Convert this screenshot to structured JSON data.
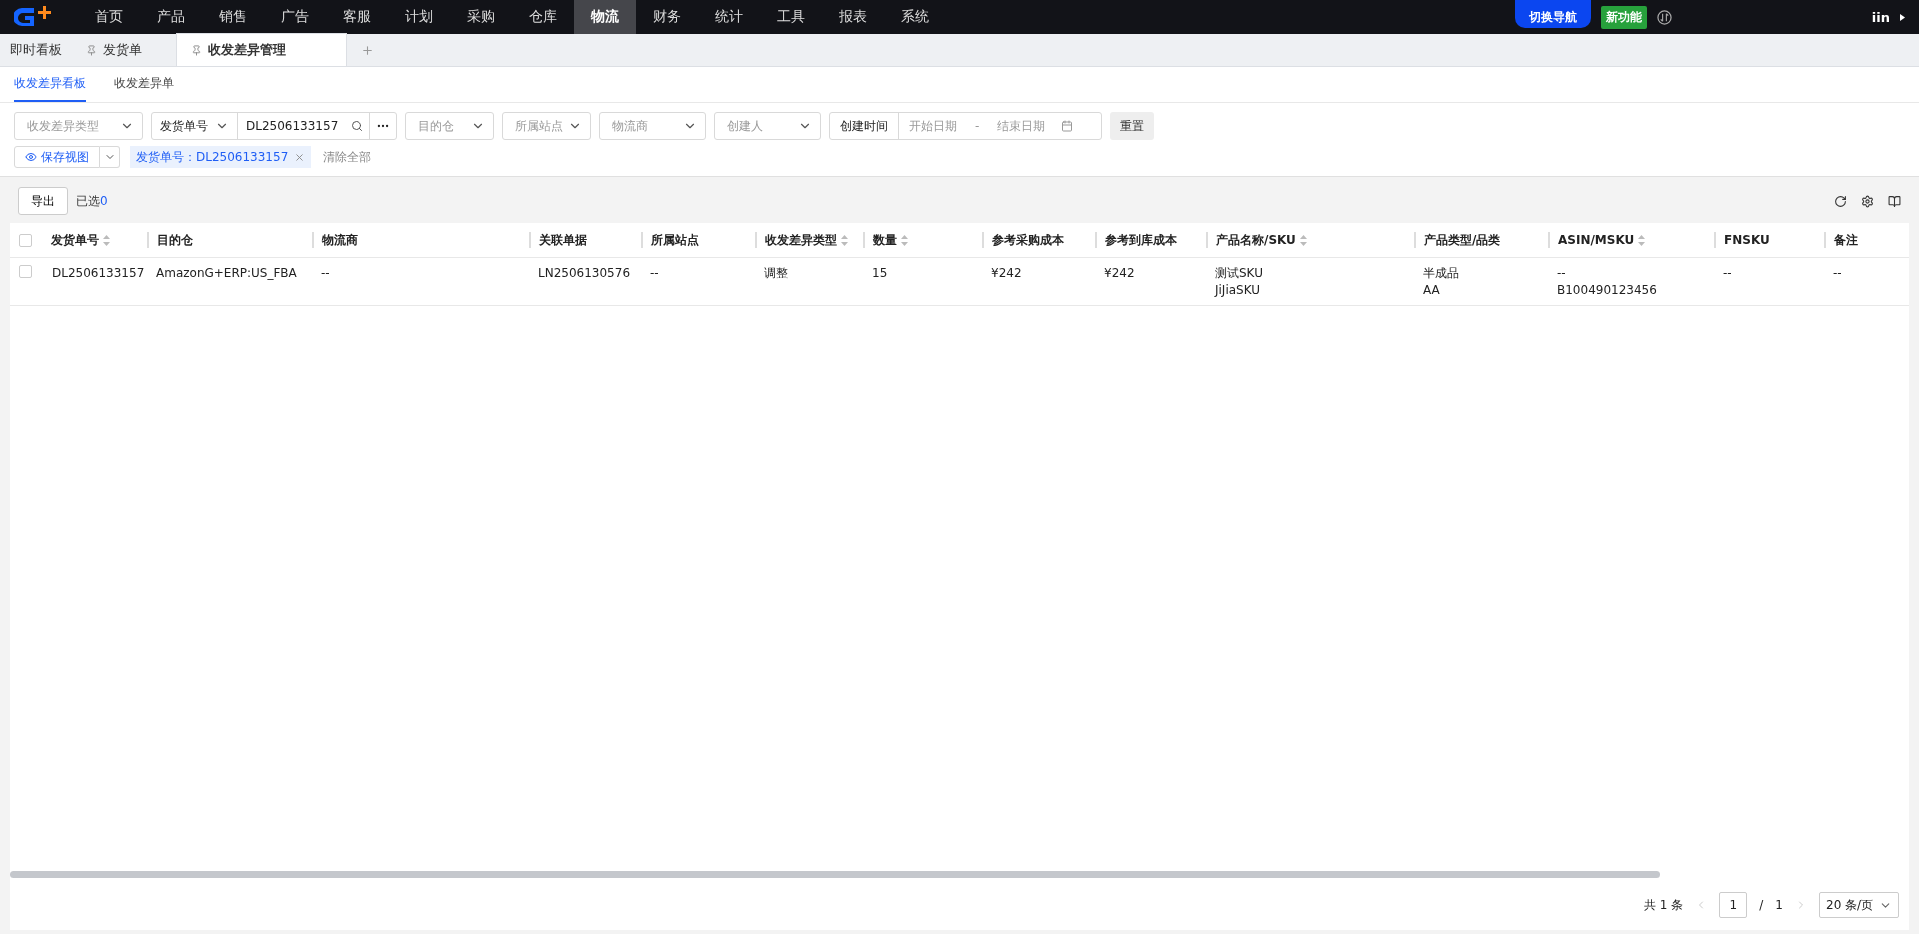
{
  "nav": {
    "items": [
      {
        "label": "首页",
        "selected": false
      },
      {
        "label": "产品",
        "selected": false
      },
      {
        "label": "销售",
        "selected": false
      },
      {
        "label": "广告",
        "selected": false
      },
      {
        "label": "客服",
        "selected": false
      },
      {
        "label": "计划",
        "selected": false
      },
      {
        "label": "采购",
        "selected": false
      },
      {
        "label": "仓库",
        "selected": false
      },
      {
        "label": "物流",
        "selected": true
      },
      {
        "label": "财务",
        "selected": false
      },
      {
        "label": "统计",
        "selected": false
      },
      {
        "label": "工具",
        "selected": false
      },
      {
        "label": "报表",
        "selected": false
      },
      {
        "label": "系统",
        "selected": false
      }
    ],
    "switch_button": "切换导航",
    "new_badge": "新功能",
    "user": "iin"
  },
  "page_tabs": [
    {
      "label": "即时看板",
      "pinned": false,
      "selected": false
    },
    {
      "label": "发货单",
      "pinned": true,
      "selected": false
    },
    {
      "label": "收发差异管理",
      "pinned": true,
      "selected": true
    }
  ],
  "sub_tabs": [
    {
      "label": "收发差异看板",
      "selected": true
    },
    {
      "label": "收发差异单",
      "selected": false
    }
  ],
  "filters": [
    {
      "kind": "select",
      "placeholder": "收发差异类型"
    },
    {
      "kind": "combo",
      "field": "发货单号",
      "value": "DL2506133157"
    },
    {
      "kind": "select",
      "placeholder": "目的仓"
    },
    {
      "kind": "select",
      "placeholder": "所属站点"
    },
    {
      "kind": "select",
      "placeholder": "物流商"
    },
    {
      "kind": "select",
      "placeholder": "创建人"
    },
    {
      "kind": "daterange",
      "label": "创建时间",
      "start_placeholder": "开始日期",
      "separator": "-",
      "end_placeholder": "结束日期"
    },
    {
      "kind": "button",
      "label": "重置"
    }
  ],
  "save_view": "保存视图",
  "active_filter": "发货单号：DL2506133157",
  "clear_all": "清除全部",
  "toolbar": {
    "export": "导出",
    "selected_label": "已选",
    "selected_count": "0"
  },
  "table": {
    "select_all_checked": false,
    "columns": [
      {
        "label": "发货单号",
        "sortable": true
      },
      {
        "label": "目的仓",
        "sortable": false
      },
      {
        "label": "物流商",
        "sortable": false
      },
      {
        "label": "关联单据",
        "sortable": false
      },
      {
        "label": "所属站点",
        "sortable": false
      },
      {
        "label": "收发差异类型",
        "sortable": true
      },
      {
        "label": "数量",
        "sortable": true
      },
      {
        "label": "参考采购成本",
        "sortable": false
      },
      {
        "label": "参考到库成本",
        "sortable": false
      },
      {
        "label": "产品名称/SKU",
        "sortable": true
      },
      {
        "label": "产品类型/品类",
        "sortable": false
      },
      {
        "label": "ASIN/MSKU",
        "sortable": true
      },
      {
        "label": "FNSKU",
        "sortable": false
      },
      {
        "label": "备注",
        "sortable": false
      }
    ],
    "rows": [
      {
        "checked": false,
        "cells": [
          [
            "DL2506133157"
          ],
          [
            "AmazonG+ERP:US_FBA"
          ],
          [
            "--"
          ],
          [
            "LN2506130576"
          ],
          [
            "--"
          ],
          [
            "调整"
          ],
          [
            "15"
          ],
          [
            "¥242"
          ],
          [
            "¥242"
          ],
          [
            "测试SKU",
            "JiJiaSKU"
          ],
          [
            "半成品",
            "AA"
          ],
          [
            "--",
            "B100490123456"
          ],
          [
            "--"
          ],
          [
            "--"
          ]
        ]
      }
    ]
  },
  "pagination": {
    "total": "共 1 条",
    "page": "1",
    "separator": "/",
    "pages": "1",
    "page_size": "20 条/页"
  }
}
